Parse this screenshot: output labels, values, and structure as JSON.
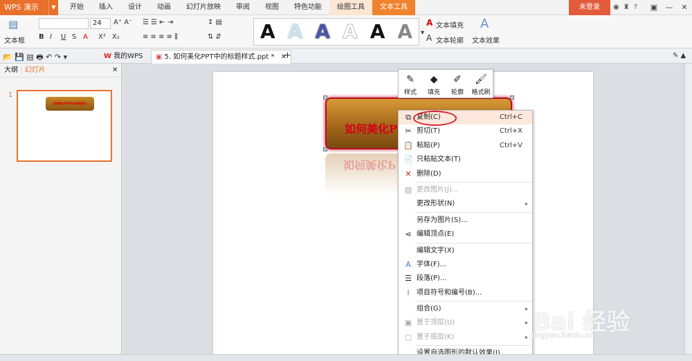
{
  "app": {
    "name": "WPS 演示",
    "login": "未登录"
  },
  "menu_tabs": [
    "开始",
    "插入",
    "设计",
    "动画",
    "幻灯片放映",
    "审阅",
    "视图",
    "特色功能",
    "绘图工具",
    "文本工具"
  ],
  "ribbon": {
    "textbox_label": "文本框",
    "font_size": "24",
    "text_fill": "文本填充",
    "text_outline": "文本轮廓",
    "text_effect": "文本效果",
    "style_letters": [
      "A",
      "A",
      "A",
      "A",
      "A",
      "A"
    ]
  },
  "doc_tabs": {
    "home": "我的WPS",
    "current": "5. 如何美化PPT中的标题样式.ppt *"
  },
  "left_pane": {
    "tab_outline": "大纲",
    "tab_slides": "幻灯片",
    "slide_number": "1",
    "thumb_text": "如何美化PPT中的标题样式"
  },
  "slide": {
    "title_text": "如何美化P"
  },
  "mini_toolbar": [
    {
      "label": "样式",
      "icon": "style-icon"
    },
    {
      "label": "填充",
      "icon": "fill-bucket-icon"
    },
    {
      "label": "轮廓",
      "icon": "outline-pen-icon"
    },
    {
      "label": "格式刷",
      "icon": "format-painter-icon"
    }
  ],
  "context_menu": [
    {
      "label": "复制(C)",
      "shortcut": "Ctrl+C",
      "icon": "copy-icon",
      "state": "highlight"
    },
    {
      "label": "剪切(T)",
      "shortcut": "Ctrl+X",
      "icon": "scissors-icon"
    },
    {
      "label": "粘贴(P)",
      "shortcut": "Ctrl+V",
      "icon": "paste-icon"
    },
    {
      "label": "只粘贴文本(T)",
      "icon": "paste-text-icon"
    },
    {
      "label": "删除(D)",
      "icon": "delete-icon"
    },
    {
      "sep": true
    },
    {
      "label": "更改图片(J)...",
      "icon": "picture-icon",
      "state": "disabled"
    },
    {
      "label": "更改形状(N)",
      "submenu": true
    },
    {
      "sep": true
    },
    {
      "label": "另存为图片(S)..."
    },
    {
      "label": "编辑顶点(E)",
      "icon": "edit-points-icon"
    },
    {
      "sep": true
    },
    {
      "label": "编辑文字(X)"
    },
    {
      "label": "字体(F)...",
      "icon": "font-icon"
    },
    {
      "label": "段落(P)...",
      "icon": "paragraph-icon"
    },
    {
      "label": "项目符号和编号(B)...",
      "icon": "bullets-icon"
    },
    {
      "sep": true
    },
    {
      "label": "组合(G)",
      "submenu": true
    },
    {
      "label": "置于顶层(U)",
      "icon": "bring-front-icon",
      "state": "disabled",
      "submenu": true
    },
    {
      "label": "置于底层(K)",
      "icon": "send-back-icon",
      "state": "disabled",
      "submenu": true
    },
    {
      "sep": true
    },
    {
      "label": "设置自选图形的默认效果(I)"
    }
  ],
  "watermark": {
    "brand": "Bai 经验",
    "url": "jingyan.baidu.com"
  },
  "colors": {
    "accent": "#e8702a",
    "highlight_oval": "#d8202a",
    "title_red": "#d4001a"
  }
}
